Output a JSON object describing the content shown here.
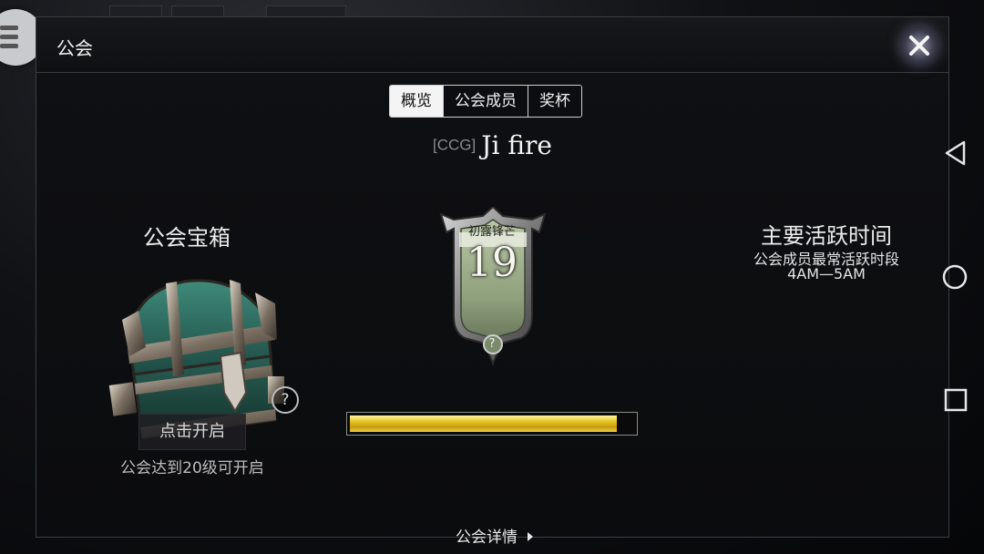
{
  "window": {
    "title": "公会"
  },
  "tabs": [
    {
      "label": "概览",
      "active": true
    },
    {
      "label": "公会成员",
      "active": false
    },
    {
      "label": "奖杯",
      "active": false
    }
  ],
  "guild": {
    "tag": "[CCG]",
    "name": "Ji fire"
  },
  "chest": {
    "title": "公会宝箱",
    "open_button": "点击开启",
    "hint": "公会达到20级可开启",
    "help_label": "?"
  },
  "rank": {
    "label": "初露锋芒",
    "level": "19",
    "help_label": "?",
    "progress": 0.94,
    "progress_color": "#e3c222"
  },
  "activity": {
    "title": "主要活跃时间",
    "subtitle": "公会成员最常活跃时段",
    "hours": "4AM—5AM"
  },
  "footer": {
    "details_link": "公会详情"
  },
  "icons": {
    "menu": "hamburger-menu-icon",
    "close": "close-icon",
    "back": "android-back-icon",
    "home": "android-home-icon",
    "recents": "android-recents-icon"
  }
}
